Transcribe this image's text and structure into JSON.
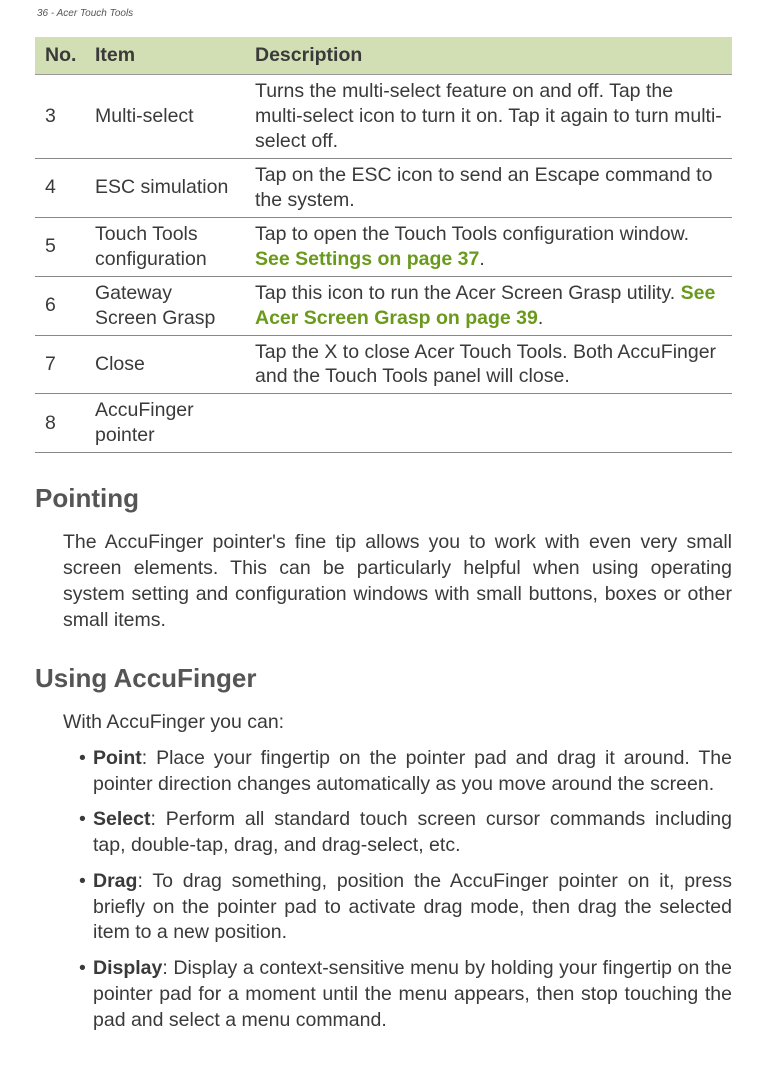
{
  "header": {
    "pageinfo": "36 - Acer Touch Tools"
  },
  "table": {
    "head": {
      "no": "No.",
      "item": "Item",
      "desc": "Description"
    },
    "rows": [
      {
        "no": "3",
        "item": "Multi-select",
        "desc_a": "Turns the multi-select feature on and off. Tap the multi-select icon to turn it on. Tap it again to turn multi-select off."
      },
      {
        "no": "4",
        "item": "ESC simulation",
        "desc_a": "Tap on the ESC icon to send an Escape command to the system."
      },
      {
        "no": "5",
        "item": "Touch Tools configuration",
        "desc_a": "Tap to open the Touch Tools configuration window. ",
        "link": "See Settings on page 37",
        "desc_b": "."
      },
      {
        "no": "6",
        "item": "Gateway Screen Grasp",
        "desc_a": "Tap this icon to run the Acer Screen Grasp utility. ",
        "link": "See Acer Screen Grasp on page 39",
        "desc_b": "."
      },
      {
        "no": "7",
        "item": "Close",
        "desc_a": "Tap the X to close Acer Touch Tools. Both AccuFinger and the Touch Tools panel will close."
      },
      {
        "no": "8",
        "item": "AccuFinger pointer",
        "desc_a": ""
      }
    ]
  },
  "sections": {
    "pointing": {
      "title": "Pointing",
      "body": "The AccuFinger pointer's fine tip allows you to work with even very small screen elements. This can be particularly helpful when using operating system setting and configuration windows with small buttons, boxes or other small items."
    },
    "using": {
      "title": "Using AccuFinger",
      "intro": "With AccuFinger you can:",
      "items": [
        {
          "head": "Point",
          "body": ": Place your fingertip on the pointer pad and drag it around. The pointer direction changes automatically as you move around the screen."
        },
        {
          "head": "Select",
          "body": ": Perform all standard touch screen cursor commands including tap, double-tap, drag, and drag-select, etc."
        },
        {
          "head": "Drag",
          "body": ": To drag something, position the AccuFinger pointer on it, press briefly on the pointer pad to activate drag mode, then drag the selected item to a new position."
        },
        {
          "head": "Display",
          "body": ": Display a context-sensitive menu by holding your fingertip on the pointer pad for a moment until the menu appears, then stop touching the pad and select a menu command."
        }
      ]
    }
  }
}
